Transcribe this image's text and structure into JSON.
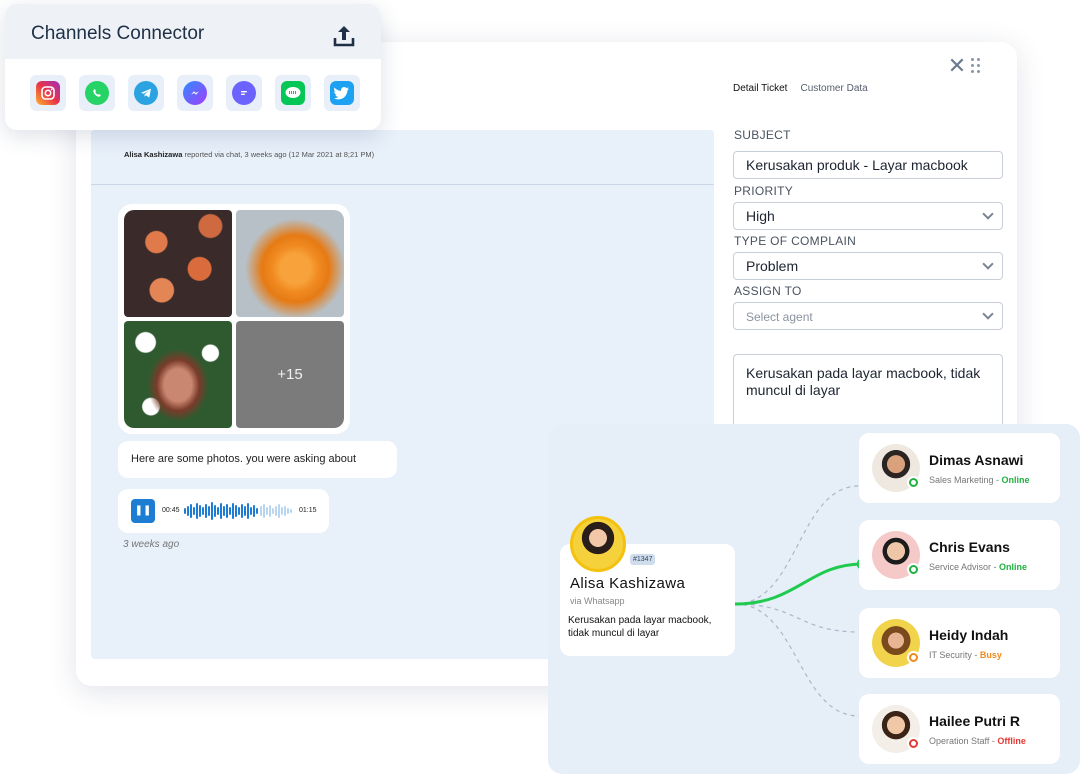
{
  "channels": {
    "title": "Channels Connector",
    "upload_icon": "upload-icon",
    "items": [
      {
        "name": "instagram",
        "icon": "instagram-icon",
        "color": "#d6249f"
      },
      {
        "name": "whatsapp",
        "icon": "whatsapp-icon",
        "color": "#25d366"
      },
      {
        "name": "telegram",
        "icon": "telegram-icon",
        "color": "#2aa3e0"
      },
      {
        "name": "messenger",
        "icon": "messenger-icon",
        "color": "#7b5cf5"
      },
      {
        "name": "chat",
        "icon": "chat-icon",
        "color": "#6c63ff"
      },
      {
        "name": "line",
        "icon": "line-icon",
        "color": "#06c755"
      },
      {
        "name": "twitter",
        "icon": "twitter-icon",
        "color": "#1da1f2"
      }
    ]
  },
  "ticket": {
    "tabs": [
      "Detail Ticket",
      "Customer Data"
    ],
    "chat": {
      "reporter": "Alisa Kashizawa",
      "reported_meta": "reported via chat, 3 weeks ago (12 Mar 2021 at 8;21 PM)",
      "more_photos": "+15",
      "message": "Here are some photos. you were asking about",
      "audio_start": "00:45",
      "audio_end": "01:15",
      "timestamp": "3 weeks ago"
    },
    "form": {
      "subject_label": "SUBJECT",
      "subject_value": "Kerusakan produk - Layar macbook",
      "priority_label": "PRIORITY",
      "priority_value": "High",
      "type_label": "TYPE OF COMPLAIN",
      "type_value": "Problem",
      "assign_label": "ASSIGN TO",
      "assign_placeholder": "Select agent",
      "notes": "Kerusakan pada layar macbook, tidak muncul di layar"
    }
  },
  "routing": {
    "customer": {
      "name": "Alisa  Kashizawa",
      "ticket_id": "#1347",
      "via": "via Whatsapp",
      "message": "Kerusakan pada layar macbook, tidak muncul di layar"
    },
    "agents": [
      {
        "name": "Dimas Asnawi",
        "role": "Sales Marketing",
        "status": "Online",
        "status_color": "#1fb141"
      },
      {
        "name": "Chris Evans",
        "role": "Service Advisor",
        "status": "Online",
        "status_color": "#1fb141"
      },
      {
        "name": "Heidy Indah",
        "role": "IT Security",
        "status": "Busy",
        "status_color": "#f08a1c"
      },
      {
        "name": "Hailee Putri R",
        "role": "Operation Staff",
        "status": "Offline",
        "status_color": "#e53935"
      }
    ],
    "connected_agent": "Chris Evans",
    "line_color": "#1ecb4f"
  }
}
